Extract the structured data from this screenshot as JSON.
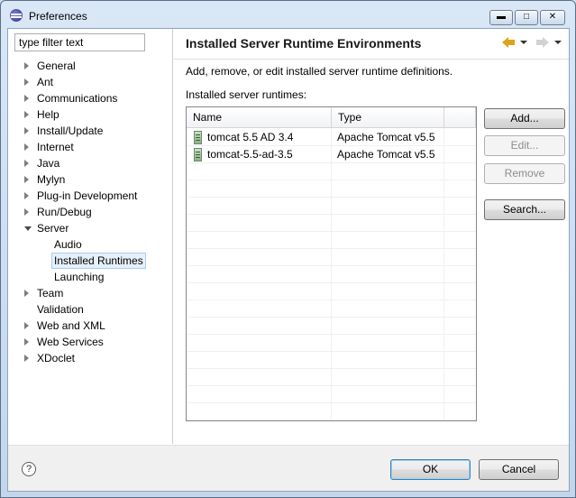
{
  "window": {
    "title": "Preferences"
  },
  "filter": {
    "value": "type filter text"
  },
  "tree": [
    {
      "label": "General",
      "expandable": true,
      "expanded": false,
      "level": 0
    },
    {
      "label": "Ant",
      "expandable": true,
      "expanded": false,
      "level": 0
    },
    {
      "label": "Communications",
      "expandable": true,
      "expanded": false,
      "level": 0
    },
    {
      "label": "Help",
      "expandable": true,
      "expanded": false,
      "level": 0
    },
    {
      "label": "Install/Update",
      "expandable": true,
      "expanded": false,
      "level": 0
    },
    {
      "label": "Internet",
      "expandable": true,
      "expanded": false,
      "level": 0
    },
    {
      "label": "Java",
      "expandable": true,
      "expanded": false,
      "level": 0
    },
    {
      "label": "Mylyn",
      "expandable": true,
      "expanded": false,
      "level": 0
    },
    {
      "label": "Plug-in Development",
      "expandable": true,
      "expanded": false,
      "level": 0
    },
    {
      "label": "Run/Debug",
      "expandable": true,
      "expanded": false,
      "level": 0
    },
    {
      "label": "Server",
      "expandable": true,
      "expanded": true,
      "level": 0
    },
    {
      "label": "Audio",
      "expandable": false,
      "expanded": false,
      "level": 1
    },
    {
      "label": "Installed Runtimes",
      "expandable": false,
      "expanded": false,
      "level": 1,
      "selected": true
    },
    {
      "label": "Launching",
      "expandable": false,
      "expanded": false,
      "level": 1
    },
    {
      "label": "Team",
      "expandable": true,
      "expanded": false,
      "level": 0
    },
    {
      "label": "Validation",
      "expandable": false,
      "expanded": false,
      "level": 0
    },
    {
      "label": "Web and XML",
      "expandable": true,
      "expanded": false,
      "level": 0
    },
    {
      "label": "Web Services",
      "expandable": true,
      "expanded": false,
      "level": 0
    },
    {
      "label": "XDoclet",
      "expandable": true,
      "expanded": false,
      "level": 0
    }
  ],
  "page": {
    "title": "Installed Server Runtime Environments",
    "description": "Add, remove, or edit installed server runtime definitions.",
    "table_label": "Installed server runtimes:",
    "columns": [
      "Name",
      "Type"
    ],
    "rows": [
      {
        "name": "tomcat 5.5 AD 3.4",
        "type": "Apache Tomcat v5.5"
      },
      {
        "name": "tomcat-5.5-ad-3.5",
        "type": "Apache Tomcat v5.5"
      }
    ],
    "buttons": {
      "add": "Add...",
      "edit": "Edit...",
      "remove": "Remove",
      "search": "Search..."
    }
  },
  "footer": {
    "ok": "OK",
    "cancel": "Cancel",
    "help": "?"
  },
  "colors": {
    "selection_bg": "#e5f0fb",
    "selection_border": "#aacbed",
    "back_arrow": "#e0a11b"
  }
}
